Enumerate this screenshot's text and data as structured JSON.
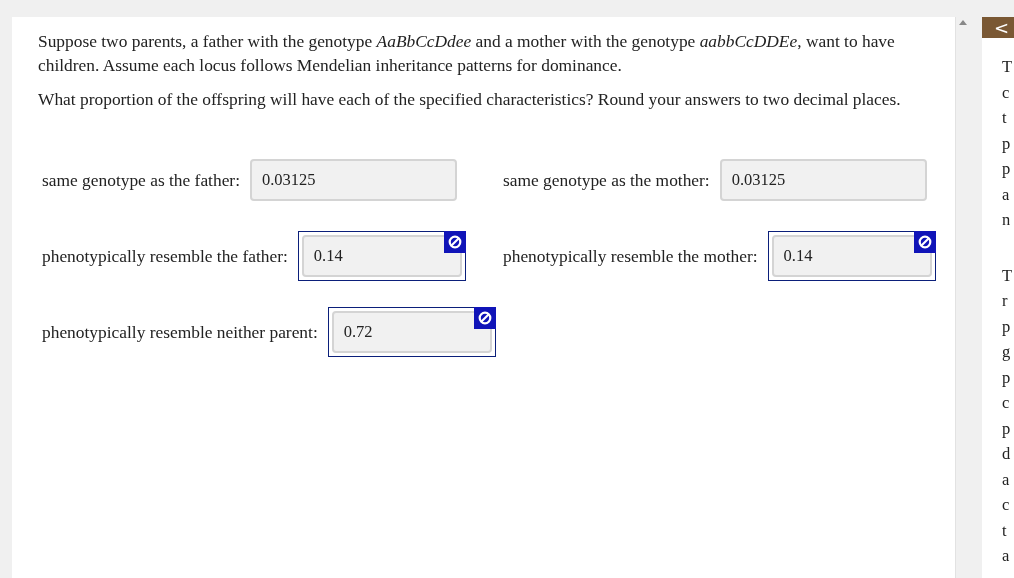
{
  "question": {
    "paragraphs": [
      "Suppose two parents, a father with the genotype *AaBbCcDdee* and a mother with the genotype *aabbCcDDEe*, want to have children. Assume each locus follows Mendelian inheritance patterns for dominance.",
      "What proportion of the offspring will have each of the specified characteristics? Round your answers to two decimal places."
    ]
  },
  "answers": [
    {
      "label": "same genotype as the father:",
      "value": "0.03125",
      "flagged": false
    },
    {
      "label": "same genotype as the mother:",
      "value": "0.03125",
      "flagged": false
    },
    {
      "label": "phenotypically resemble the father:",
      "value": "0.14",
      "flagged": true
    },
    {
      "label": "phenotypically resemble the mother:",
      "value": "0.14",
      "flagged": true
    },
    {
      "label": "phenotypically resemble neither parent:",
      "value": "0.72",
      "flagged": true
    }
  ],
  "side_panel": {
    "collapse_button": "<",
    "paragraphs": [
      [
        "T",
        "c",
        "t",
        "p",
        "p",
        "a",
        "n"
      ],
      [
        "T",
        "r",
        "p",
        "g",
        "p",
        "c",
        "p",
        "d",
        "a",
        "c",
        "t",
        "a"
      ]
    ]
  }
}
